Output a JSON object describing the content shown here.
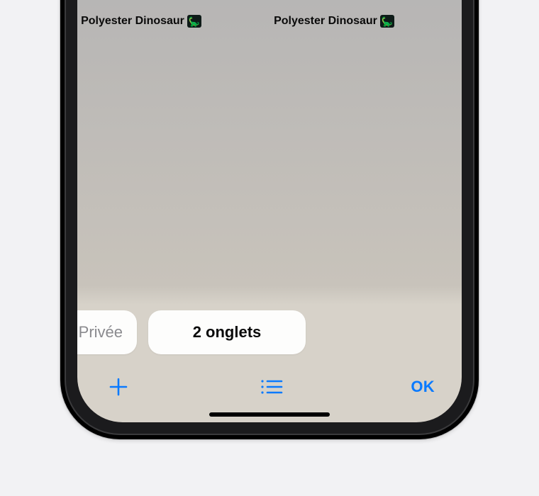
{
  "tabs": {
    "thumb1_title": "Polyester Dinosaur",
    "thumb2_title": "Polyester Dinosaur",
    "icon_emoji": "🦕"
  },
  "groups": {
    "private_label": "Privée",
    "tabs_label": "2 onglets"
  },
  "toolbar": {
    "done_label": "OK"
  },
  "colors": {
    "accent": "#0a7aff"
  }
}
